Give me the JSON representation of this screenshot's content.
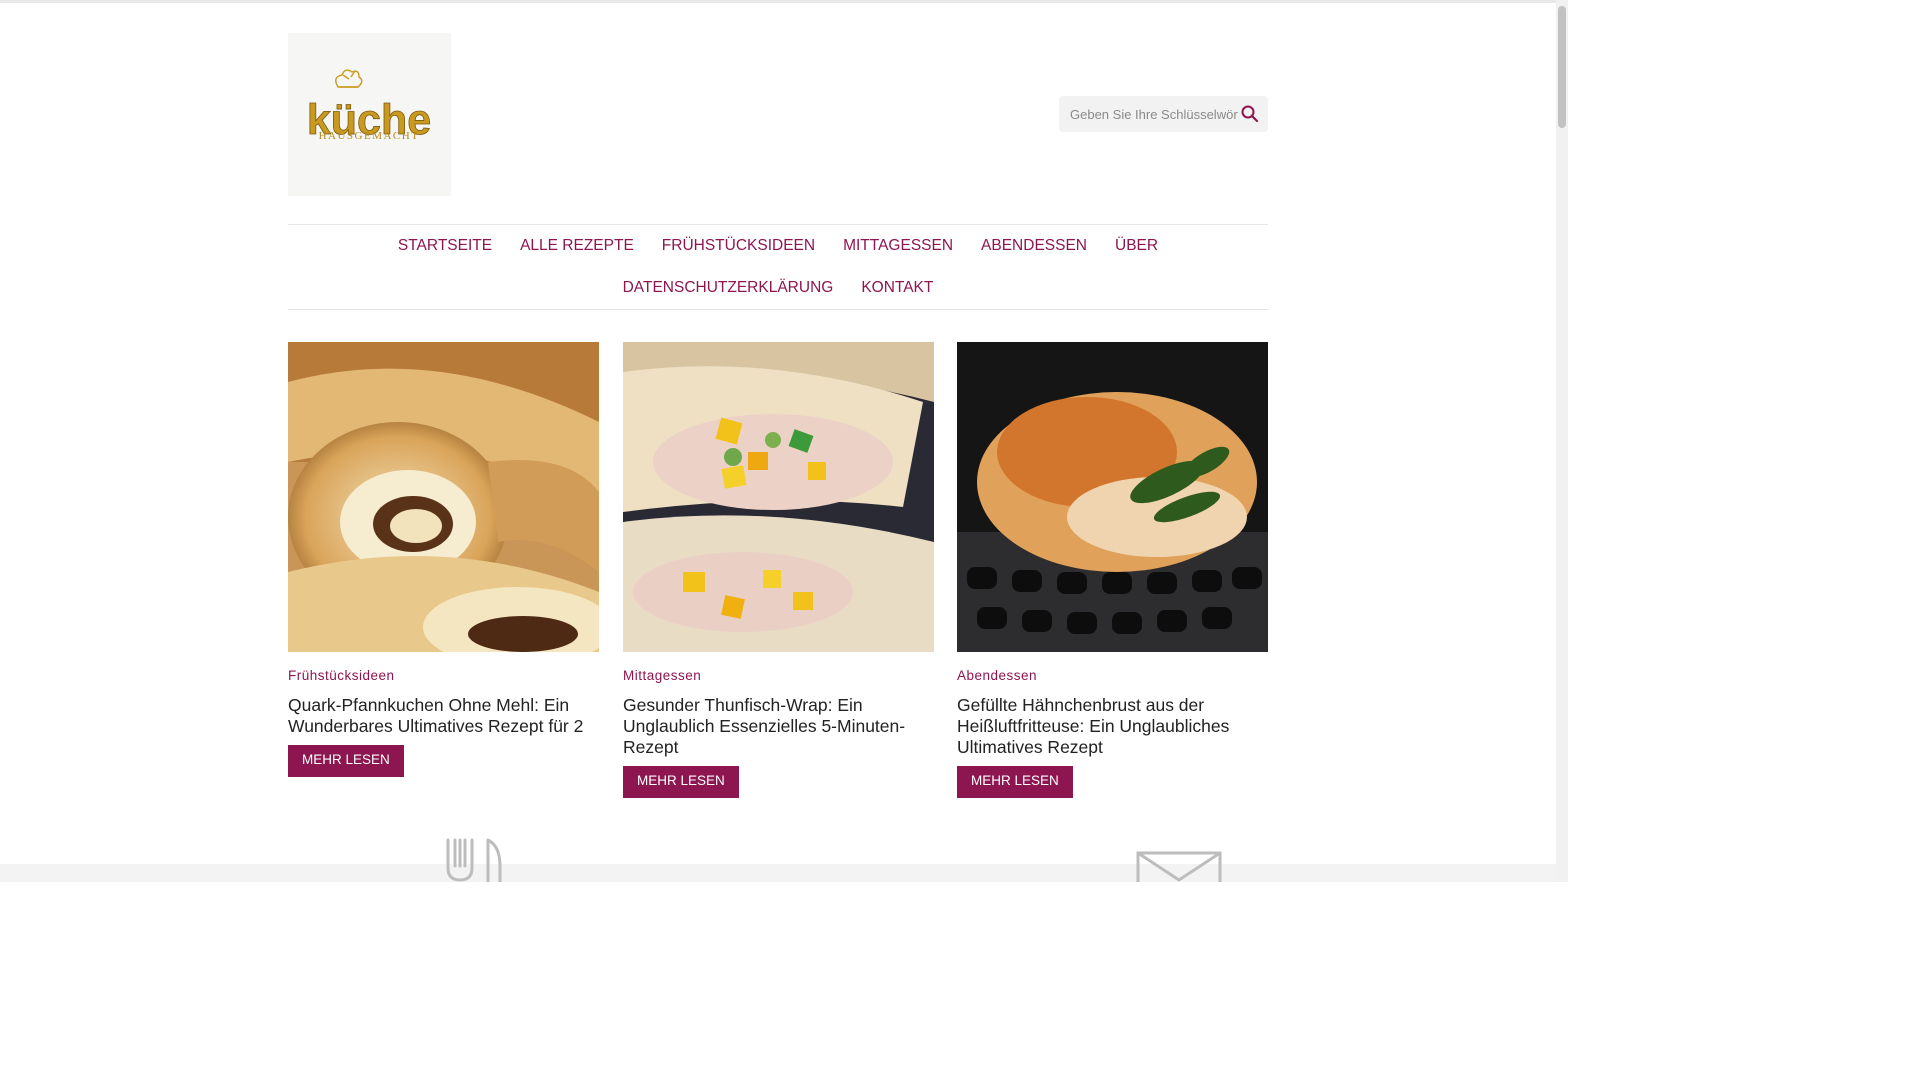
{
  "header": {
    "logo": {
      "text": "küche",
      "subtext": "HAUSGEMACHT",
      "icon": "chef-hat-icon"
    },
    "search": {
      "placeholder": "Geben Sie Ihre Schlüsselwörter ein",
      "icon": "search-icon"
    }
  },
  "nav": {
    "row1": [
      "Startseite",
      "Alle Rezepte",
      "Frühstücksideen",
      "Mittagessen",
      "Abendessen",
      "Über"
    ],
    "row2": [
      "Datenschutzerklärung",
      "Kontakt"
    ]
  },
  "cards": [
    {
      "category": "Frühstücksideen",
      "title": "Quark-Pfannkuchen Ohne Mehl: Ein Wunderbares Ultimatives Rezept für 2",
      "button": "MEHR LESEN",
      "image": "rolled-pancakes"
    },
    {
      "category": "Mittagessen",
      "title": "Gesunder Thunfisch-Wrap: Ein Unglaublich Essenzielles 5-Minuten-Rezept",
      "button": "MEHR LESEN",
      "image": "tuna-wrap"
    },
    {
      "category": "Abendessen",
      "title": "Gefüllte Hähnchenbrust aus der Heißluftfritteuse: Ein Unglaubliches Ultimatives Rezept",
      "button": "MEHR LESEN",
      "image": "stuffed-chicken-breast"
    }
  ],
  "footer": {
    "icons": [
      "fork-knife-icon",
      "mail-icon"
    ]
  },
  "colors": {
    "accent": "#8d1550",
    "logo_gold": "#c99a1f",
    "text": "#222222"
  }
}
